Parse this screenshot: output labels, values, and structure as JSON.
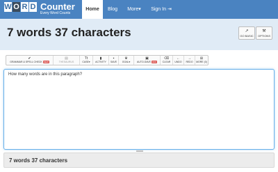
{
  "logo": {
    "letters": [
      "W",
      "O",
      "R",
      "D"
    ],
    "name": "Counter",
    "tagline": "Every Word Counts"
  },
  "nav": {
    "home": "Home",
    "blog": "Blog",
    "more": "More",
    "more_caret": "▾",
    "signin": "Sign In",
    "signin_icon": "⇥"
  },
  "header": {
    "title": "7 words 37 characters"
  },
  "buttons": {
    "go_basic": {
      "label": "GO BASIC",
      "icon": "external-link-icon",
      "glyph": "↗"
    },
    "options": {
      "label": "OPTIONS",
      "icon": "wrench-icon",
      "glyph": "⚒"
    }
  },
  "toolbar": {
    "grammar": {
      "label": "GRAMMAR & SPELL CHECK",
      "badge": "NEW",
      "icon": "check-icon",
      "glyph": "✔"
    },
    "thesaurus": {
      "label": "THESAURUS",
      "icon": "book-icon",
      "glyph": "▤"
    },
    "case": {
      "label": "CASE▾",
      "icon": "text-case-icon",
      "glyph": "Tt"
    },
    "activity": {
      "label": "ACTIVITY",
      "icon": "bar-chart-icon",
      "glyph": "▮"
    },
    "save": {
      "label": "SAVE",
      "icon": "save-icon",
      "glyph": "▪"
    },
    "goal": {
      "label": "GOAL▾",
      "icon": "trophy-icon",
      "glyph": "♛"
    },
    "autosave": {
      "label": "AUTO-SAVE",
      "badge": "OFF",
      "icon": "autosave-icon",
      "glyph": "▣"
    },
    "clear": {
      "label": "CLEAR",
      "icon": "trash-icon",
      "glyph": "⌫"
    },
    "undo": {
      "label": "UNDO",
      "icon": "undo-arrow-icon",
      "glyph": "←"
    },
    "redo": {
      "label": "REDO",
      "icon": "redo-arrow-icon",
      "glyph": "→"
    },
    "more": {
      "label": "MORE (0)",
      "icon": "grid-icon",
      "glyph": "⊞"
    }
  },
  "editor": {
    "text": "How many words are in this paragraph?"
  },
  "footer": {
    "summary": "7 words 37 characters"
  },
  "colors": {
    "navbar": "#4a83c1",
    "hero": "#e0ebf6",
    "badge": "#d9534f",
    "focus": "#66afe9"
  }
}
